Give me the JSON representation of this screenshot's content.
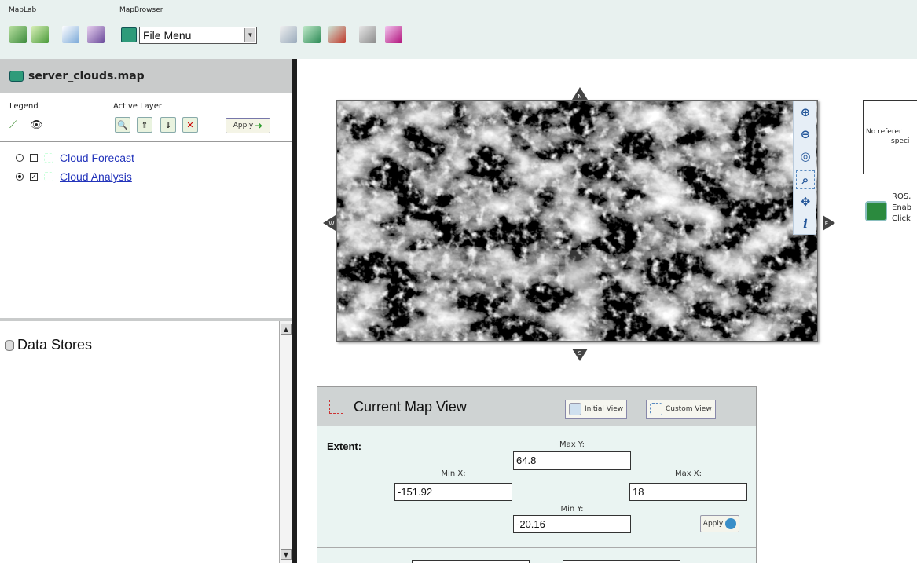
{
  "toolbar": {
    "maplab_label": "MapLab",
    "mapbrowser_label": "MapBrowser",
    "file_menu_value": "File Menu"
  },
  "map_panel": {
    "title": "server_clouds.map",
    "legend_label": "Legend",
    "active_layer_label": "Active Layer",
    "apply_label": "Apply",
    "layers": [
      {
        "name": "Cloud Forecast",
        "active": false,
        "visible": false
      },
      {
        "name": "Cloud Analysis",
        "active": true,
        "visible": true
      }
    ]
  },
  "data_stores": {
    "title": "Data Stores"
  },
  "reference": {
    "line1": "No referer",
    "line2": "speci"
  },
  "ros": {
    "line1": "ROS,",
    "line2": "Enab",
    "line3": "Click"
  },
  "current_view": {
    "title": "Current Map View",
    "initial_view_label": "Initial View",
    "custom_view_label": "Custom View",
    "extent_label": "Extent:",
    "max_y_label": "Max Y:",
    "min_x_label": "Min X:",
    "max_x_label": "Max X:",
    "min_y_label": "Min Y:",
    "max_y": "64.8",
    "min_x": "-151.92",
    "max_x": "18",
    "min_y": "-20.16",
    "apply_label": "Apply"
  },
  "colors": {
    "toolbar_bg": "#e8f1ef",
    "panel_header": "#c9cbcb",
    "link": "#2233bb",
    "view_panel_bg": "#eaf4f2"
  }
}
